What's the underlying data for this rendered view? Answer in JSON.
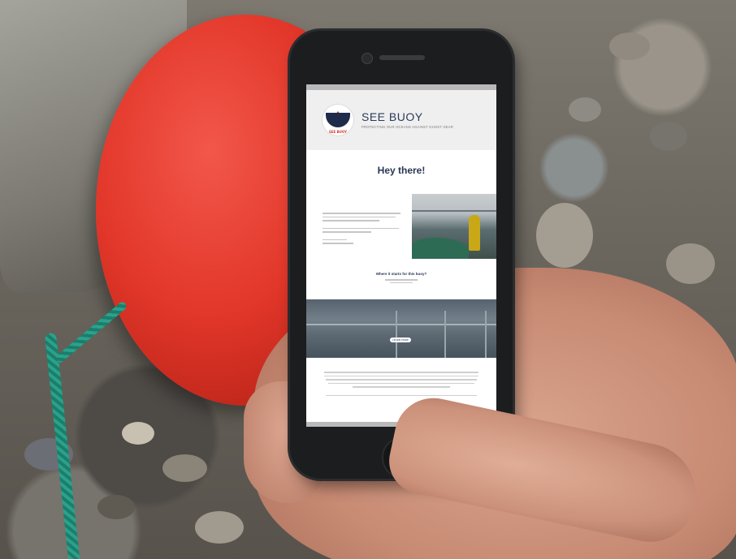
{
  "scene": {
    "description_icons": [
      "red-buoy",
      "hand-holding-phone",
      "green-rope"
    ]
  },
  "website": {
    "brand_name": "SEE BUOY",
    "tagline": "PROTECTING OUR OCEANS AGAINST GHOST GEAR",
    "logo_text": "SEE BUOY",
    "greeting": "Hey there!",
    "section_question": "Where it starts for this buoy?",
    "banner_button": "LEARN MORE"
  },
  "colors": {
    "buoy": "#e2372a",
    "navy": "#2a3556",
    "rope": "#29a28c"
  }
}
